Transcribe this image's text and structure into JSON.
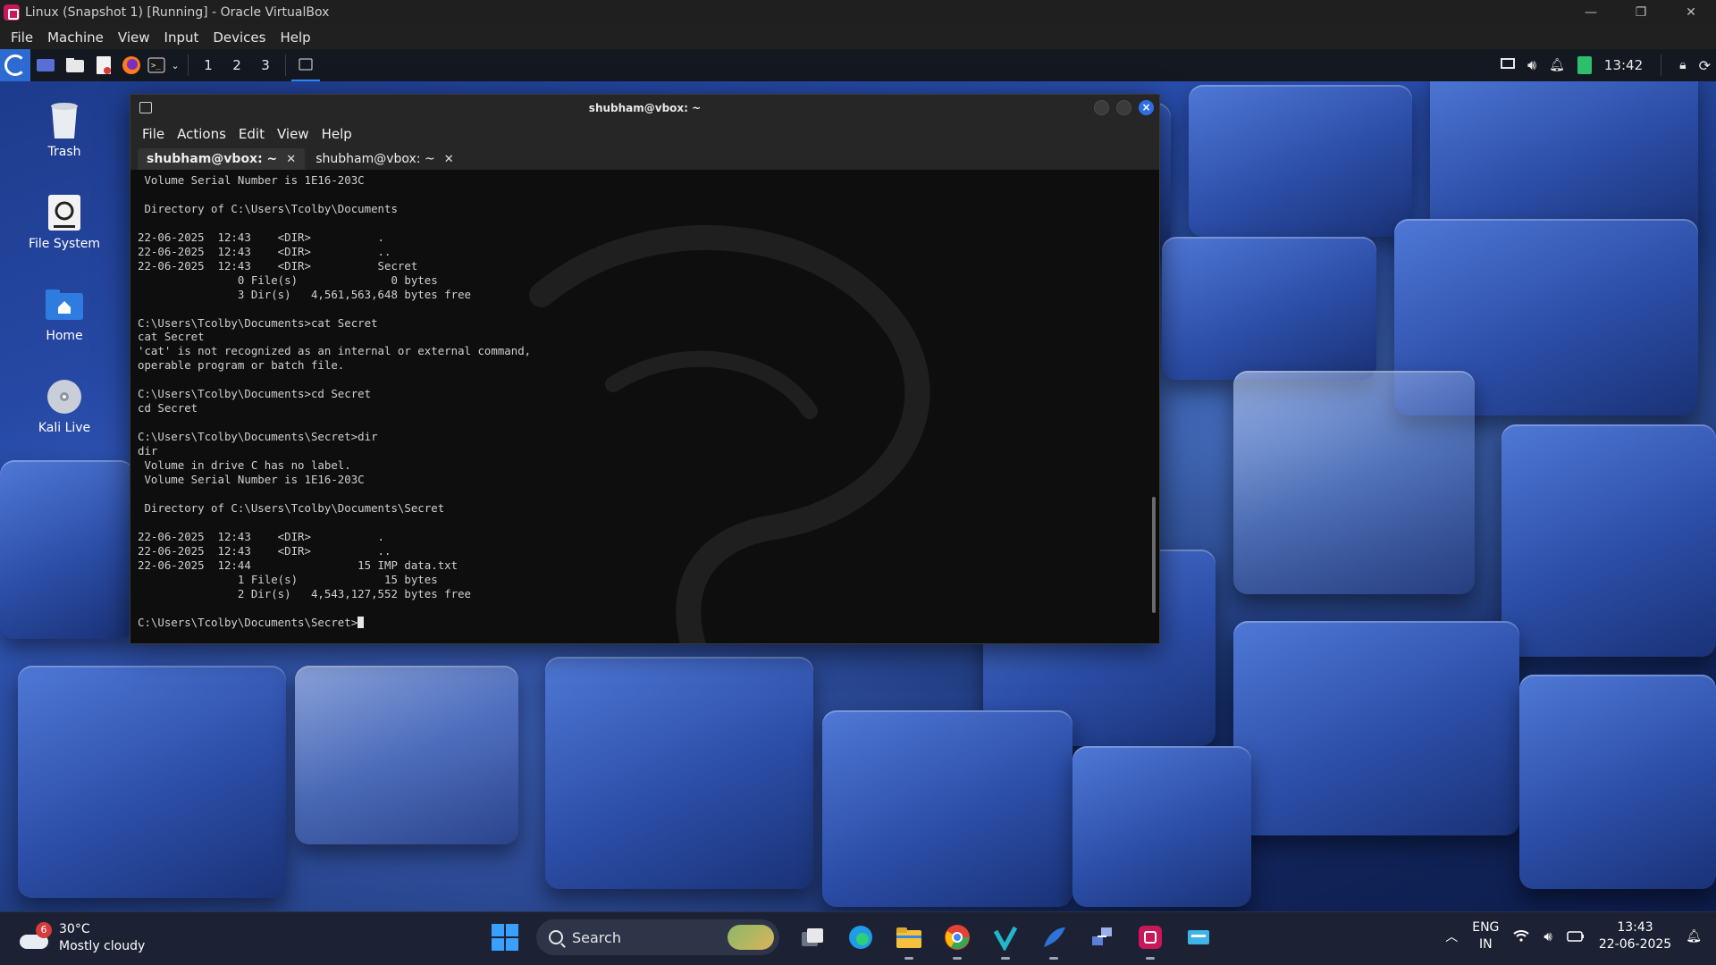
{
  "host": {
    "title": "Linux (Snapshot 1) [Running] - Oracle VirtualBox",
    "controls": [
      "—",
      "❐",
      "✕"
    ],
    "menu": [
      "File",
      "Machine",
      "View",
      "Input",
      "Devices",
      "Help"
    ]
  },
  "panel": {
    "workspaces": [
      "1",
      "2",
      "3"
    ],
    "time": "13:42"
  },
  "desktop_icons": [
    {
      "label": "Trash",
      "icon": "trash-icon"
    },
    {
      "label": "File System",
      "icon": "drive-icon"
    },
    {
      "label": "Home",
      "icon": "home-folder-icon"
    },
    {
      "label": "Kali Live",
      "icon": "disc-icon"
    }
  ],
  "terminal": {
    "title": "shubham@vbox: ~",
    "menu": [
      "File",
      "Actions",
      "Edit",
      "View",
      "Help"
    ],
    "tabs": [
      {
        "label": "shubham@vbox: ~",
        "active": true
      },
      {
        "label": "shubham@vbox: ~",
        "active": false
      }
    ],
    "output": [
      " Volume Serial Number is 1E16-203C",
      "",
      " Directory of C:\\Users\\Tcolby\\Documents",
      "",
      "22-06-2025  12:43    <DIR>          .",
      "22-06-2025  12:43    <DIR>          ..",
      "22-06-2025  12:43    <DIR>          Secret",
      "               0 File(s)              0 bytes",
      "               3 Dir(s)   4,561,563,648 bytes free",
      "",
      "C:\\Users\\Tcolby\\Documents>cat Secret",
      "cat Secret",
      "'cat' is not recognized as an internal or external command,",
      "operable program or batch file.",
      "",
      "C:\\Users\\Tcolby\\Documents>cd Secret",
      "cd Secret",
      "",
      "C:\\Users\\Tcolby\\Documents\\Secret>dir",
      "dir",
      " Volume in drive C has no label.",
      " Volume Serial Number is 1E16-203C",
      "",
      " Directory of C:\\Users\\Tcolby\\Documents\\Secret",
      "",
      "22-06-2025  12:43    <DIR>          .",
      "22-06-2025  12:43    <DIR>          ..",
      "22-06-2025  12:44                15 IMP data.txt",
      "               1 File(s)             15 bytes",
      "               2 Dir(s)   4,543,127,552 bytes free",
      ""
    ],
    "prompt": "C:\\Users\\Tcolby\\Documents\\Secret>"
  },
  "taskbar": {
    "weather_badge": "6",
    "temperature": "30°C",
    "condition": "Mostly cloudy",
    "search_label": "Search",
    "lang_top": "ENG",
    "lang_bottom": "IN",
    "time": "13:43",
    "date": "22-06-2025"
  }
}
